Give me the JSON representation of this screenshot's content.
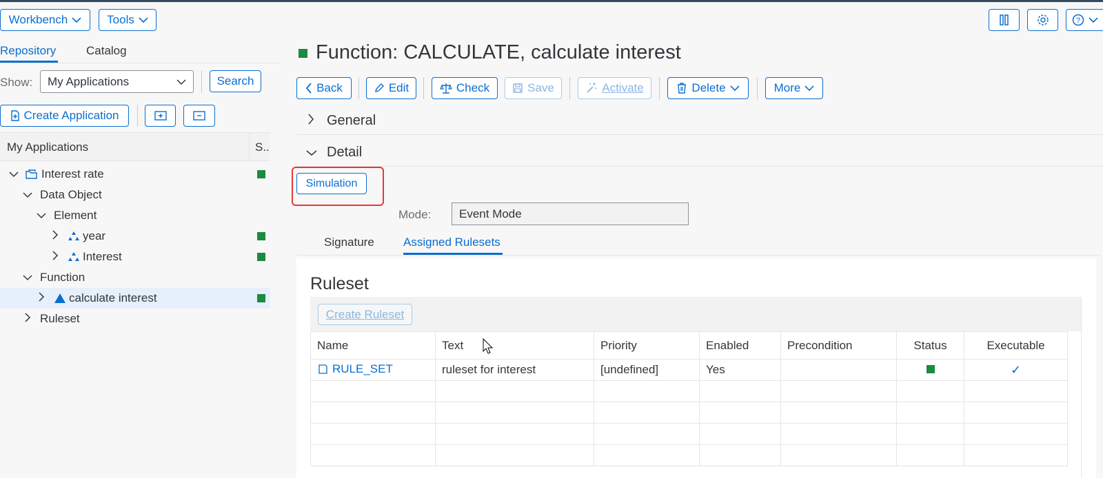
{
  "header": {
    "workbench_label": "Workbench",
    "tools_label": "Tools"
  },
  "left": {
    "tabs": [
      {
        "label": "Repository"
      },
      {
        "label": "Catalog"
      }
    ],
    "show_label": "Show:",
    "show_value": "My Applications",
    "search_label": "Search",
    "create_app_label": "Create Application",
    "tree_header": {
      "name": "My Applications",
      "status": "S.."
    },
    "tree": [
      {
        "label": "Interest rate"
      },
      {
        "label": "Data Object"
      },
      {
        "label": "Element"
      },
      {
        "label": "year"
      },
      {
        "label": "Interest"
      },
      {
        "label": "Function"
      },
      {
        "label": "calculate interest"
      },
      {
        "label": "Ruleset"
      }
    ]
  },
  "main": {
    "title": "Function: CALCULATE, calculate interest",
    "toolbar": {
      "back": "Back",
      "edit": "Edit",
      "check": "Check",
      "save": "Save",
      "activate": "Activate",
      "delete": "Delete",
      "more": "More"
    },
    "sections": {
      "general": "General",
      "detail": "Detail"
    },
    "simulation_label": "Simulation",
    "mode_label": "Mode:",
    "mode_value": "Event Mode",
    "subtabs": [
      {
        "label": "Signature"
      },
      {
        "label": "Assigned Rulesets"
      }
    ],
    "ruleset_title": "Ruleset",
    "create_ruleset_label": "Create Ruleset",
    "table": {
      "columns": [
        "Name",
        "Text",
        "Priority",
        "Enabled",
        "Precondition",
        "Status",
        "Executable"
      ],
      "rows": [
        {
          "name": "RULE_SET",
          "text": "ruleset for interest",
          "priority": "[undefined]",
          "enabled": "Yes",
          "precondition": "",
          "status": "active",
          "executable": "✓"
        }
      ]
    }
  },
  "colors": {
    "accent": "#0a6ed1",
    "status_green": "#1a8b3f",
    "highlight_red": "#e53935"
  }
}
